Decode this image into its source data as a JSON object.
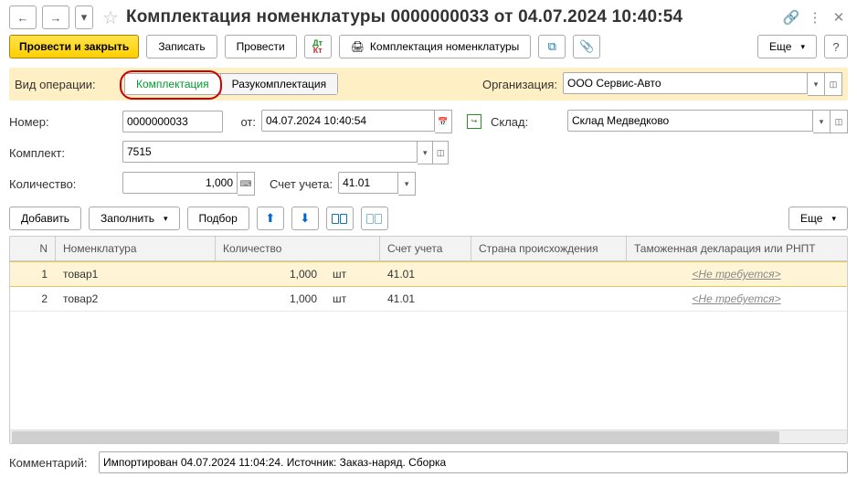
{
  "title": "Комплектация номенклатуры 0000000033 от 04.07.2024 10:40:54",
  "toolbar": {
    "post_close": "Провести и закрыть",
    "write": "Записать",
    "post": "Провести",
    "print": "Комплектация номенклатуры",
    "more": "Еще"
  },
  "op": {
    "label": "Вид операции:",
    "opt1": "Комплектация",
    "opt2": "Разукомплектация",
    "org_label": "Организация:",
    "org_value": "ООО Сервис-Авто"
  },
  "f": {
    "num_label": "Номер:",
    "num": "0000000033",
    "date_label": "от:",
    "date": "04.07.2024 10:40:54",
    "wh_label": "Склад:",
    "wh": "Склад Медведково",
    "kit_label": "Комплект:",
    "kit": "7515",
    "qty_label": "Количество:",
    "qty": "1,000",
    "acc_label": "Счет учета:",
    "acc": "41.01"
  },
  "tb2": {
    "add": "Добавить",
    "fill": "Заполнить",
    "pick": "Подбор",
    "more": "Еще"
  },
  "hdr": {
    "n": "N",
    "nom": "Номенклатура",
    "qty": "Количество",
    "acc": "Счет учета",
    "ctry": "Страна происхождения",
    "decl": "Таможенная декларация или РНПТ"
  },
  "rows": [
    {
      "n": "1",
      "nom": "товар1",
      "qty": "1,000",
      "unit": "шт",
      "acc": "41.01",
      "decl": "<Не требуется>"
    },
    {
      "n": "2",
      "nom": "товар2",
      "qty": "1,000",
      "unit": "шт",
      "acc": "41.01",
      "decl": "<Не требуется>"
    }
  ],
  "footer": {
    "label": "Комментарий:",
    "value": "Импортирован 04.07.2024 11:04:24. Источник: Заказ-наряд. Сборка"
  }
}
